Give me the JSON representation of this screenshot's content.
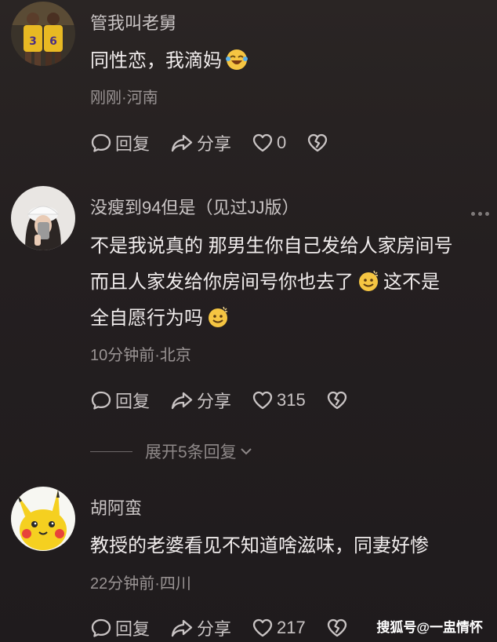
{
  "comments": [
    {
      "username": "管我叫老舅",
      "text_lines": [
        "同性恋，我滴妈"
      ],
      "meta": "刚刚·河南",
      "reply_label": "回复",
      "share_label": "分享",
      "like_count": "0"
    },
    {
      "username": "没瘦到94但是（见过JJ版）",
      "line1": "不是我说真的 那男生你自己发给人家房间号",
      "line2": "而且人家发给你房间号你也去了",
      "line2b": "这不是",
      "line3": "全自愿行为吗",
      "meta": "10分钟前·北京",
      "reply_label": "回复",
      "share_label": "分享",
      "like_count": "315"
    },
    {
      "username": "胡阿蛮",
      "text_lines": [
        "教授的老婆看见不知道啥滋味，同妻好惨"
      ],
      "meta": "22分钟前·四川",
      "reply_label": "回复",
      "share_label": "分享",
      "like_count": "217"
    }
  ],
  "expand_replies": "展开5条回复",
  "watermark": "搜狐号@一盅情怀",
  "colors": {
    "background": "#241f20",
    "text": "#f0ecec",
    "muted": "#9a9494",
    "emoji": "#f5c542"
  }
}
